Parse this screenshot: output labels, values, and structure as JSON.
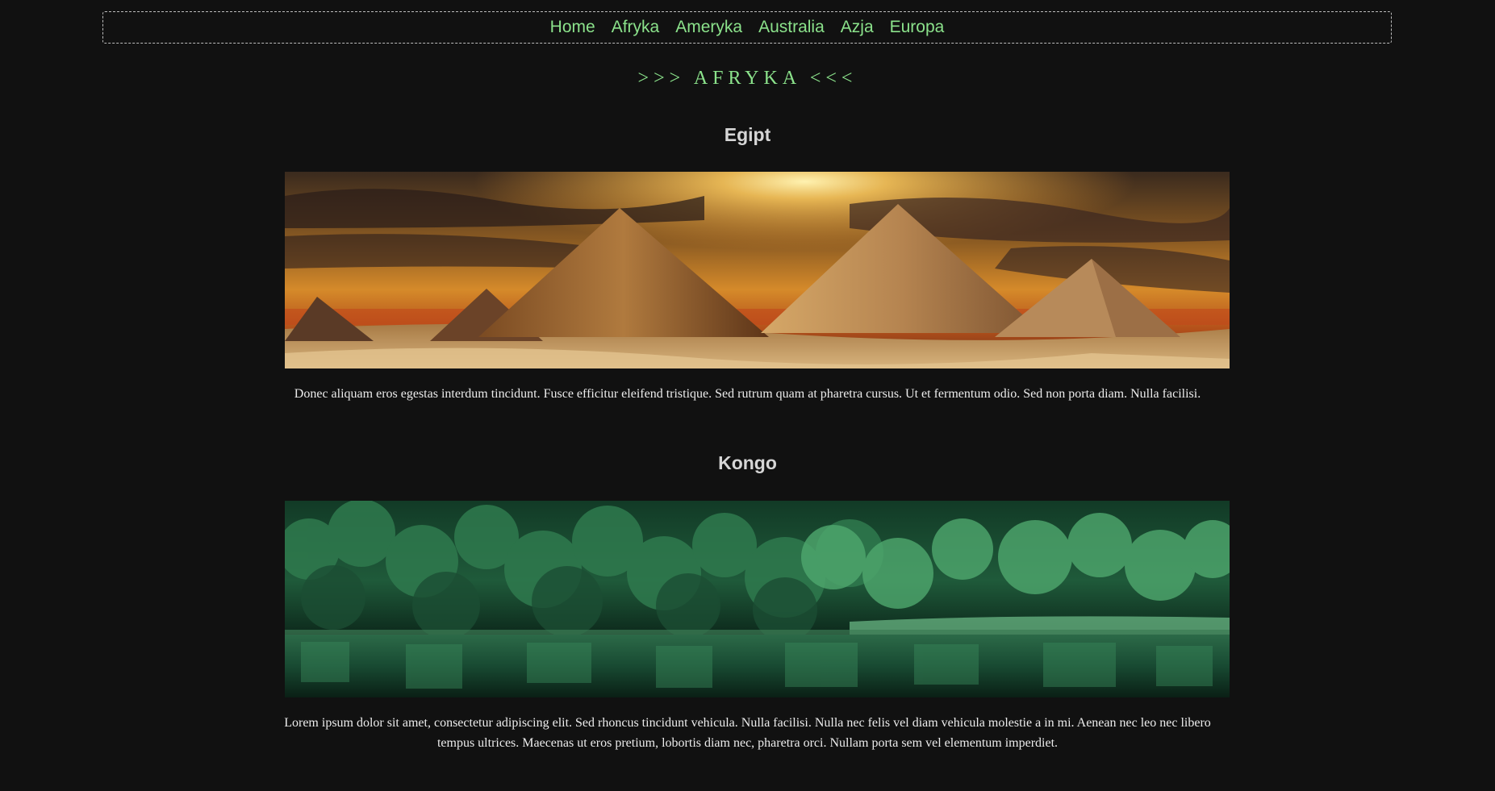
{
  "nav": {
    "items": [
      {
        "label": "Home"
      },
      {
        "label": "Afryka"
      },
      {
        "label": "Ameryka"
      },
      {
        "label": "Australia"
      },
      {
        "label": "Azja"
      },
      {
        "label": "Europa"
      }
    ]
  },
  "page": {
    "title": ">>> AFRYKA <<<"
  },
  "sections": [
    {
      "heading": "Egipt",
      "image": "pyramids-sunset-image",
      "text": "Donec aliquam eros egestas interdum tincidunt. Fusce efficitur eleifend tristique. Sed rutrum quam at pharetra cursus. Ut et fermentum odio. Sed non porta diam. Nulla facilisi."
    },
    {
      "heading": "Kongo",
      "image": "forest-lake-image",
      "text": "Lorem ipsum dolor sit amet, consectetur adipiscing elit. Sed rhoncus tincidunt vehicula. Nulla facilisi. Nulla nec felis vel diam vehicula molestie a in mi. Aenean nec leo nec libero tempus ultrices. Maecenas ut eros pretium, lobortis diam nec, pharetra orci. Nullam porta sem vel elementum imperdiet."
    }
  ],
  "colors": {
    "background": "#111111",
    "accent": "#8be28b",
    "heading": "#d6d6d6",
    "text": "#ececec"
  }
}
